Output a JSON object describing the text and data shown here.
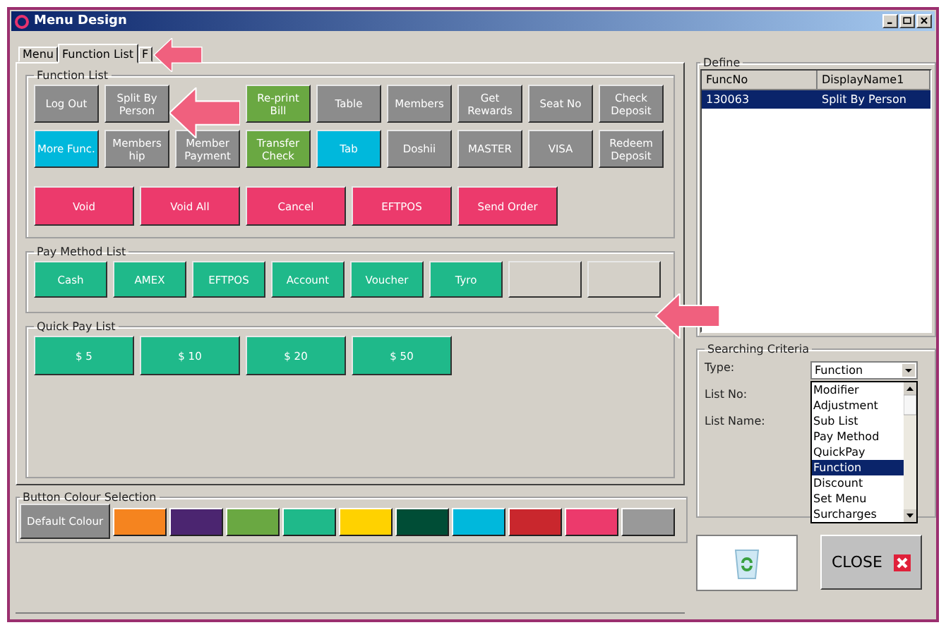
{
  "window": {
    "title": "Menu Design"
  },
  "tabs": [
    {
      "label": "Menu",
      "selected": false
    },
    {
      "label": "Function List",
      "selected": true
    },
    {
      "label": "F",
      "selected": false
    }
  ],
  "function_list": {
    "title": "Function List",
    "rows": [
      [
        {
          "kind": "button",
          "label": "Log Out",
          "color": "#8c8c8c"
        },
        {
          "kind": "button",
          "label": "Split By Person",
          "color": "#8c8c8c"
        },
        {
          "kind": "covered"
        },
        {
          "kind": "button",
          "label": "Re-print Bill",
          "color": "#6aa842"
        },
        {
          "kind": "button",
          "label": "Table",
          "color": "#8c8c8c"
        },
        {
          "kind": "button",
          "label": "Members",
          "color": "#8c8c8c"
        },
        {
          "kind": "button",
          "label": "Get Rewards",
          "color": "#8c8c8c"
        },
        {
          "kind": "button",
          "label": "Seat No",
          "color": "#8c8c8c"
        },
        {
          "kind": "button",
          "label": "Check Deposit",
          "color": "#8c8c8c"
        }
      ],
      [
        {
          "kind": "button",
          "label": "More Func.",
          "color": "#00b8dc"
        },
        {
          "kind": "button",
          "label": "Members hip",
          "color": "#8c8c8c"
        },
        {
          "kind": "button",
          "label": "Member Payment",
          "color": "#8c8c8c"
        },
        {
          "kind": "button",
          "label": "Transfer Check",
          "color": "#6aa842"
        },
        {
          "kind": "button",
          "label": "Tab",
          "color": "#00b8dc"
        },
        {
          "kind": "button",
          "label": "Doshii",
          "color": "#8c8c8c"
        },
        {
          "kind": "button",
          "label": "MASTER",
          "color": "#8c8c8c"
        },
        {
          "kind": "button",
          "label": "VISA",
          "color": "#8c8c8c"
        },
        {
          "kind": "button",
          "label": "Redeem Deposit",
          "color": "#8c8c8c"
        }
      ]
    ],
    "large_buttons": [
      {
        "label": "Void",
        "color": "#ec3a6c"
      },
      {
        "label": "Void All",
        "color": "#ec3a6c"
      },
      {
        "label": "Cancel",
        "color": "#ec3a6c"
      },
      {
        "label": "EFTPOS",
        "color": "#ec3a6c"
      },
      {
        "label": "Send Order",
        "color": "#ec3a6c"
      }
    ]
  },
  "pay_method_list": {
    "title": "Pay Method List",
    "buttons": [
      {
        "kind": "button",
        "label": "Cash",
        "color": "#1fb98a"
      },
      {
        "kind": "button",
        "label": "AMEX",
        "color": "#1fb98a"
      },
      {
        "kind": "button",
        "label": "EFTPOS",
        "color": "#1fb98a"
      },
      {
        "kind": "button",
        "label": "Account",
        "color": "#1fb98a"
      },
      {
        "kind": "button",
        "label": "Voucher",
        "color": "#1fb98a"
      },
      {
        "kind": "button",
        "label": "Tyro",
        "color": "#1fb98a"
      },
      {
        "kind": "blank",
        "color": "#d4d0c8"
      },
      {
        "kind": "blank",
        "color": "#d4d0c8"
      }
    ]
  },
  "quick_pay_list": {
    "title": "Quick Pay List",
    "buttons": [
      {
        "label": "$ 5",
        "color": "#1fb98a"
      },
      {
        "label": "$ 10",
        "color": "#1fb98a"
      },
      {
        "label": "$ 20",
        "color": "#1fb98a"
      },
      {
        "label": "$ 50",
        "color": "#1fb98a"
      }
    ]
  },
  "button_colour_selection": {
    "title": "Button Colour Selection",
    "default_button": "Default Colour",
    "swatches": [
      {
        "color": "#f5841f"
      },
      {
        "color": "#4b2570"
      },
      {
        "color": "#6aa842"
      },
      {
        "color": "#1fb98a"
      },
      {
        "color": "#ffd200"
      },
      {
        "color": "#004d36"
      },
      {
        "color": "#00b8dc"
      },
      {
        "color": "#c9272d"
      },
      {
        "color": "#ec3a6c"
      },
      {
        "color": "#999999"
      }
    ]
  },
  "define": {
    "title": "Define",
    "columns": [
      "FuncNo",
      "DisplayName1"
    ],
    "rows": [
      {
        "cells": [
          "130063",
          "Split By Person"
        ],
        "selected": true
      }
    ]
  },
  "searching_criteria": {
    "title": "Searching Criteria",
    "type_label": "Type:",
    "type_value": "Function",
    "list_no_label": "List No:",
    "list_name_label": "List Name:",
    "dropdown_options": [
      {
        "label": "Modifier",
        "selected": false
      },
      {
        "label": "Adjustment",
        "selected": false
      },
      {
        "label": "Sub List",
        "selected": false
      },
      {
        "label": "Pay Method",
        "selected": false
      },
      {
        "label": "QuickPay",
        "selected": false
      },
      {
        "label": "Function",
        "selected": true
      },
      {
        "label": "Discount",
        "selected": false
      },
      {
        "label": "Set Menu",
        "selected": false
      },
      {
        "label": "Surcharges",
        "selected": false
      }
    ]
  },
  "close_button": "CLOSE"
}
